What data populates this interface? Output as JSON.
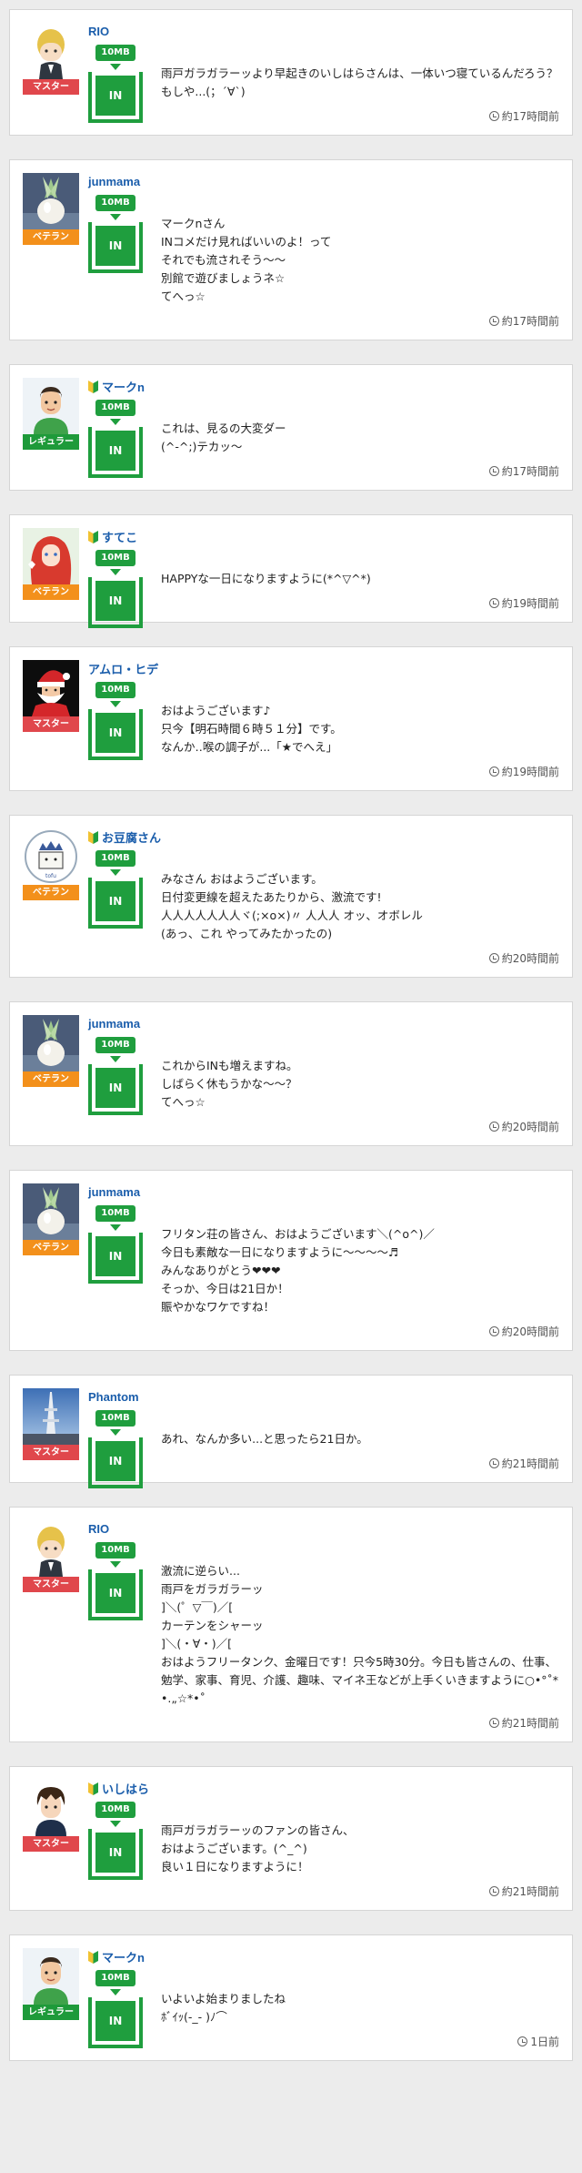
{
  "posts": [
    {
      "name": "RIO",
      "rank": "マスター",
      "rank_class": "master",
      "beginner": false,
      "avatar": "blonde-character-avatar",
      "mb": "10MB",
      "in": "IN",
      "time": "約17時間前",
      "min_h": 112,
      "text": "雨戸ガラガラーッより早起きのいしはらさんは、一体いつ寝ているんだろう？もしや...(；´∀`)"
    },
    {
      "name": "junmama",
      "rank": "ベテラン",
      "rank_class": "veteran",
      "beginner": false,
      "avatar": "turnip-avatar",
      "mb": "10MB",
      "in": "IN",
      "time": "約17時間前",
      "min_h": 128,
      "text": "マークnさん\nINコメだけ見ればいいのよ！って\nそれでも流されそう〜〜\n別館で遊びましょうネ☆\nてへっ☆"
    },
    {
      "name": "マークn",
      "rank": "レギュラー",
      "rank_class": "regular",
      "beginner": true,
      "avatar": "man-green-shirt-avatar",
      "mb": "10MB",
      "in": "IN",
      "time": "約17時間前",
      "min_h": 112,
      "text": "これは、見るの大変ダー\n(^-^;)テカッ〜"
    },
    {
      "name": "すてこ",
      "rank": "ベテラン",
      "rank_class": "veteran",
      "beginner": true,
      "avatar": "red-hair-girl-avatar",
      "mb": "10MB",
      "in": "IN",
      "time": "約19時間前",
      "min_h": 112,
      "text": "HAPPYな一日になりますように(*^▽^*)"
    },
    {
      "name": "アムロ・ヒデ",
      "rank": "マスター",
      "rank_class": "master",
      "beginner": false,
      "avatar": "santa-avatar",
      "mb": "10MB",
      "in": "IN",
      "time": "約19時間前",
      "min_h": 112,
      "text": "おはようございます♪\n只今【明石時間６時５１分】です。\nなんか‥喉の調子が...「★でへえ」"
    },
    {
      "name": "お豆腐さん",
      "rank": "ベテラン",
      "rank_class": "veteran",
      "beginner": true,
      "avatar": "tofu-avatar",
      "mb": "10MB",
      "in": "IN",
      "time": "約20時間前",
      "min_h": 112,
      "text": "みなさん おはようございます。\n日付変更線を超えたあたりから、激流です!\n人人人人人人人ヾ(;×o×)〃 人人人 オッ、オボレル\n(あっ、これ やってみたかったの)"
    },
    {
      "name": "junmama",
      "rank": "ベテラン",
      "rank_class": "veteran",
      "beginner": false,
      "avatar": "turnip-avatar",
      "mb": "10MB",
      "in": "IN",
      "time": "約20時間前",
      "min_h": 112,
      "text": "これからINも増えますね。\nしばらく休もうかな〜〜？\nてへっ☆"
    },
    {
      "name": "junmama",
      "rank": "ベテラン",
      "rank_class": "veteran",
      "beginner": false,
      "avatar": "turnip-avatar",
      "mb": "10MB",
      "in": "IN",
      "time": "約20時間前",
      "min_h": 112,
      "text": "フリタン荘の皆さん、おはようございます＼(^o^)／\n今日も素敵な一日になりますように〜〜〜〜♬\nみんなありがとう❤❤❤\nそっか、今日は21日か！\n賑やかなワケですね！"
    },
    {
      "name": "Phantom",
      "rank": "マスター",
      "rank_class": "master",
      "beginner": false,
      "avatar": "tower-photo-avatar",
      "mb": "10MB",
      "in": "IN",
      "time": "約21時間前",
      "min_h": 112,
      "text": "あれ、なんか多い...と思ったら21日か。"
    },
    {
      "name": "RIO",
      "rank": "マスター",
      "rank_class": "master",
      "beginner": false,
      "avatar": "blonde-character-avatar",
      "mb": "10MB",
      "in": "IN",
      "time": "約21時間前",
      "min_h": 112,
      "text": "激流に逆らい...\n雨戸をガラガラーッ\n]＼(゜▽￣)／[\nカーテンをシャーッ\n]＼(・∀・)／[\nおはようフリータンク、金曜日です！只今5時30分。今日も皆さんの、仕事、勉学、家事、育児、介護、趣味、マイネ王などが上手くいきますように○•°˚*•.„☆*•˚"
    },
    {
      "name": "いしはら",
      "rank": "マスター",
      "rank_class": "master",
      "beginner": true,
      "avatar": "dark-hair-boy-avatar",
      "mb": "10MB",
      "in": "IN",
      "time": "約21時間前",
      "min_h": 112,
      "text": "雨戸ガラガラーッのファンの皆さん、\nおはようございます。(^_^)\n良い１日になりますように！"
    },
    {
      "name": "マークn",
      "rank": "レギュラー",
      "rank_class": "regular",
      "beginner": true,
      "avatar": "man-green-shirt-avatar",
      "mb": "10MB",
      "in": "IN",
      "time": "1日前",
      "min_h": 112,
      "text": "いよいよ始まりましたね\nﾎﾞｲｯ(-_- )ﾉ⌒"
    }
  ]
}
